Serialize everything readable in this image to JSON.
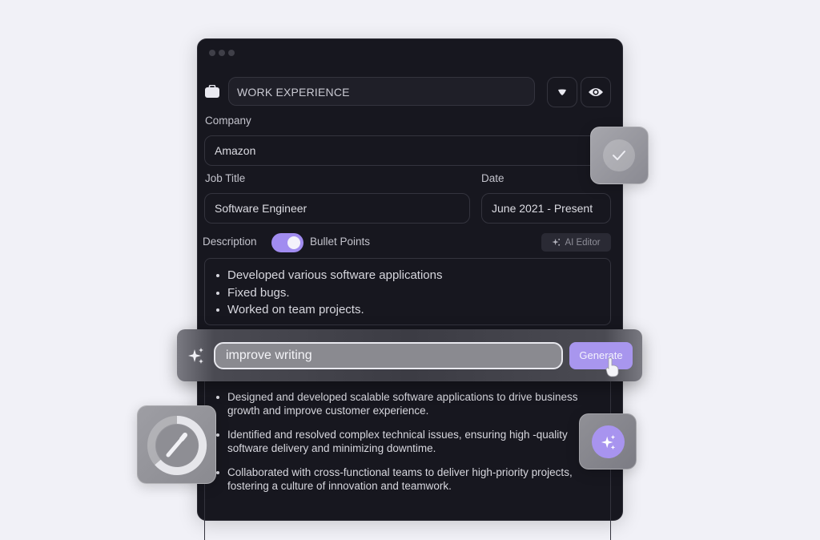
{
  "section": {
    "title": "WORK EXPERIENCE",
    "icon": "briefcase-icon",
    "actions": [
      {
        "name": "collapse",
        "icon": "chevron-down-icon"
      },
      {
        "name": "visibility",
        "icon": "eye-icon"
      }
    ]
  },
  "form": {
    "company_label": "Company",
    "company_value": "Amazon",
    "job_title_label": "Job Title",
    "job_title_value": "Software Engineer",
    "date_label": "Date",
    "date_value": "June 2021 - Present",
    "description_label": "Description",
    "bullet_toggle_label": "Bullet Points",
    "bullet_toggle_on": true,
    "ai_editor_label": "AI Editor",
    "description_items": [
      "Developed various software applications",
      "Fixed bugs.",
      "Worked on team projects."
    ]
  },
  "ai_bar": {
    "prompt_value": "improve writing",
    "generate_label": "Generate"
  },
  "generated": {
    "items": [
      "Designed and developed scalable software applications to drive business growth and improve customer experience.",
      "Identified and resolved complex technical issues, ensuring high -quality software delivery and minimizing downtime.",
      "Collaborated with cross-functional teams to deliver high-priority projects, fostering a culture of innovation and teamwork."
    ]
  },
  "colors": {
    "accent": "#a18cf0",
    "window_bg": "#17171f",
    "page_bg": "#f1f1f7"
  }
}
